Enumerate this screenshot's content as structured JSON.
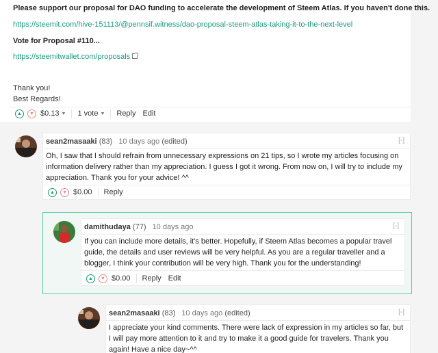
{
  "post": {
    "line1": "Please support our proposal for DAO funding to accelerate the development of Steem Atlas. If you haven't done this.",
    "link1": "https://steemit.com/hive-151113/@pennsif.witness/dao-proposal-steem-atlas-taking-it-to-the-next-level",
    "vote_line": "Vote for Proposal #110...",
    "link2": "https://steemitwallet.com/proposals",
    "thanks": "Thank you!",
    "regards": "Best Regards!",
    "payout": "$0.13",
    "votes": "1 vote",
    "reply": "Reply",
    "edit": "Edit"
  },
  "comments": [
    {
      "author": "sean2masaaki",
      "rep": "(83)",
      "time": "10 days ago",
      "edited": "(edited)",
      "collapse": "[-]",
      "body": "Oh, I saw that I should refrain from unnecessary expressions on 21 tips, so I wrote my articles focusing on information delivery rather than my appreciation. I guess I got it wrong. From now on, I will try to include my appreciation. Thank you for your advice! ^^",
      "payout": "$0.00",
      "reply": "Reply"
    },
    {
      "author": "damithudaya",
      "rep": "(77)",
      "time": "10 days ago",
      "collapse": "[-]",
      "body": "If you can include more details, it's better. Hopefully, if Steem Atlas becomes a popular travel guide, the details and user reviews will be very helpful. As you are a regular traveller and a blogger, I think your contribution will be very high. Thank you for the understanding!",
      "payout": "$0.00",
      "reply": "Reply",
      "edit": "Edit"
    },
    {
      "author": "sean2masaaki",
      "rep": "(83)",
      "time": "10 days ago",
      "edited": "(edited)",
      "collapse": "[-]",
      "body": "I appreciate your kind comments. There were lack of expression in my articles so far, but I will pay more attention to it and try to make it a good guide for travelers. Thank you again! Have a nice day~^^"
    }
  ],
  "icons": {
    "upvote": "chevron-up-icon",
    "downvote": "chevron-down-icon",
    "external": "external-link-icon"
  },
  "colors": {
    "accent": "#1a9a7a",
    "highlight_border": "#4fd0a3",
    "downvote": "#e08a8a"
  }
}
